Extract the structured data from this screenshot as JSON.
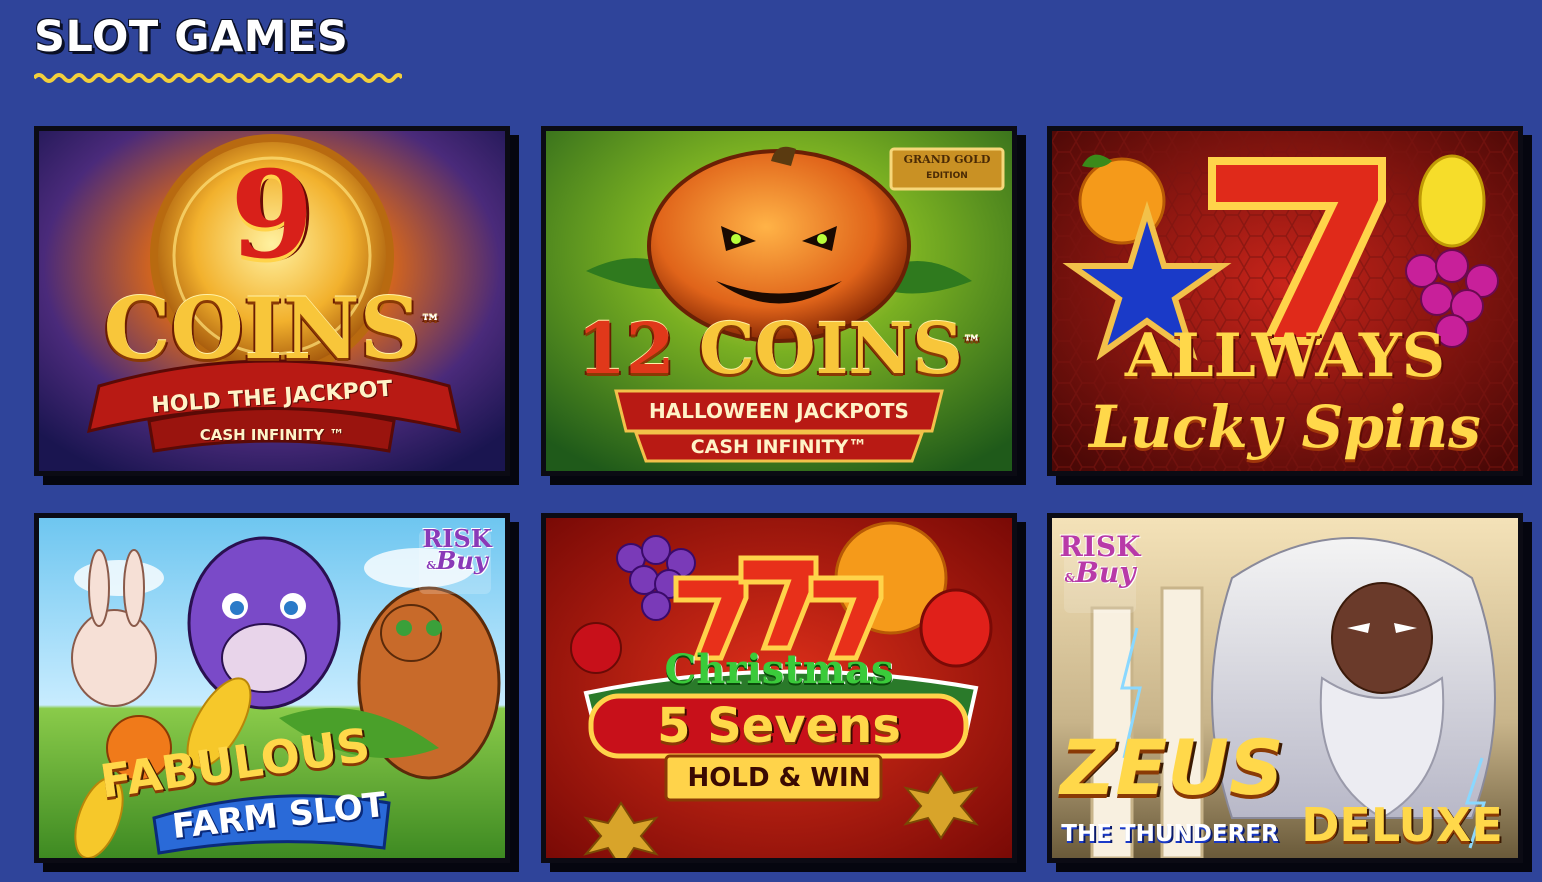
{
  "section": {
    "title": "SLOT GAMES"
  },
  "colors": {
    "background": "#2f449a",
    "underline": "#f2d03c",
    "card_border": "#0b0b14"
  },
  "games": [
    {
      "title_top": "9",
      "title_main": "COINS",
      "tm": "™",
      "ribbon1": "HOLD THE JACKPOT",
      "ribbon2": "CASH INFINITY ™"
    },
    {
      "title_num": "12",
      "title_main": "COINS",
      "tm": "™",
      "badge_line1": "GRAND GOLD",
      "badge_line2": "EDITION",
      "ribbon1": "HALLOWEEN JACKPOTS",
      "ribbon2": "CASH INFINITY™"
    },
    {
      "title_num": "7",
      "title_main": "ALLWAYS",
      "subtitle": "Lucky Spins"
    },
    {
      "badge_line1": "RISK",
      "badge_amp": "&",
      "badge_line2": "Buy",
      "title_main": "FABULOUS",
      "subtitle": "FARM SLOT"
    },
    {
      "title_num": "777",
      "title_top": "Christmas",
      "title_main": "5 Sevens",
      "ribbon1": "HOLD & WIN"
    },
    {
      "badge_line1": "RISK",
      "badge_amp": "&",
      "badge_line2": "Buy",
      "title_main": "ZEUS",
      "subtitle": "THE THUNDERER",
      "suffix": "DELUXE"
    }
  ]
}
